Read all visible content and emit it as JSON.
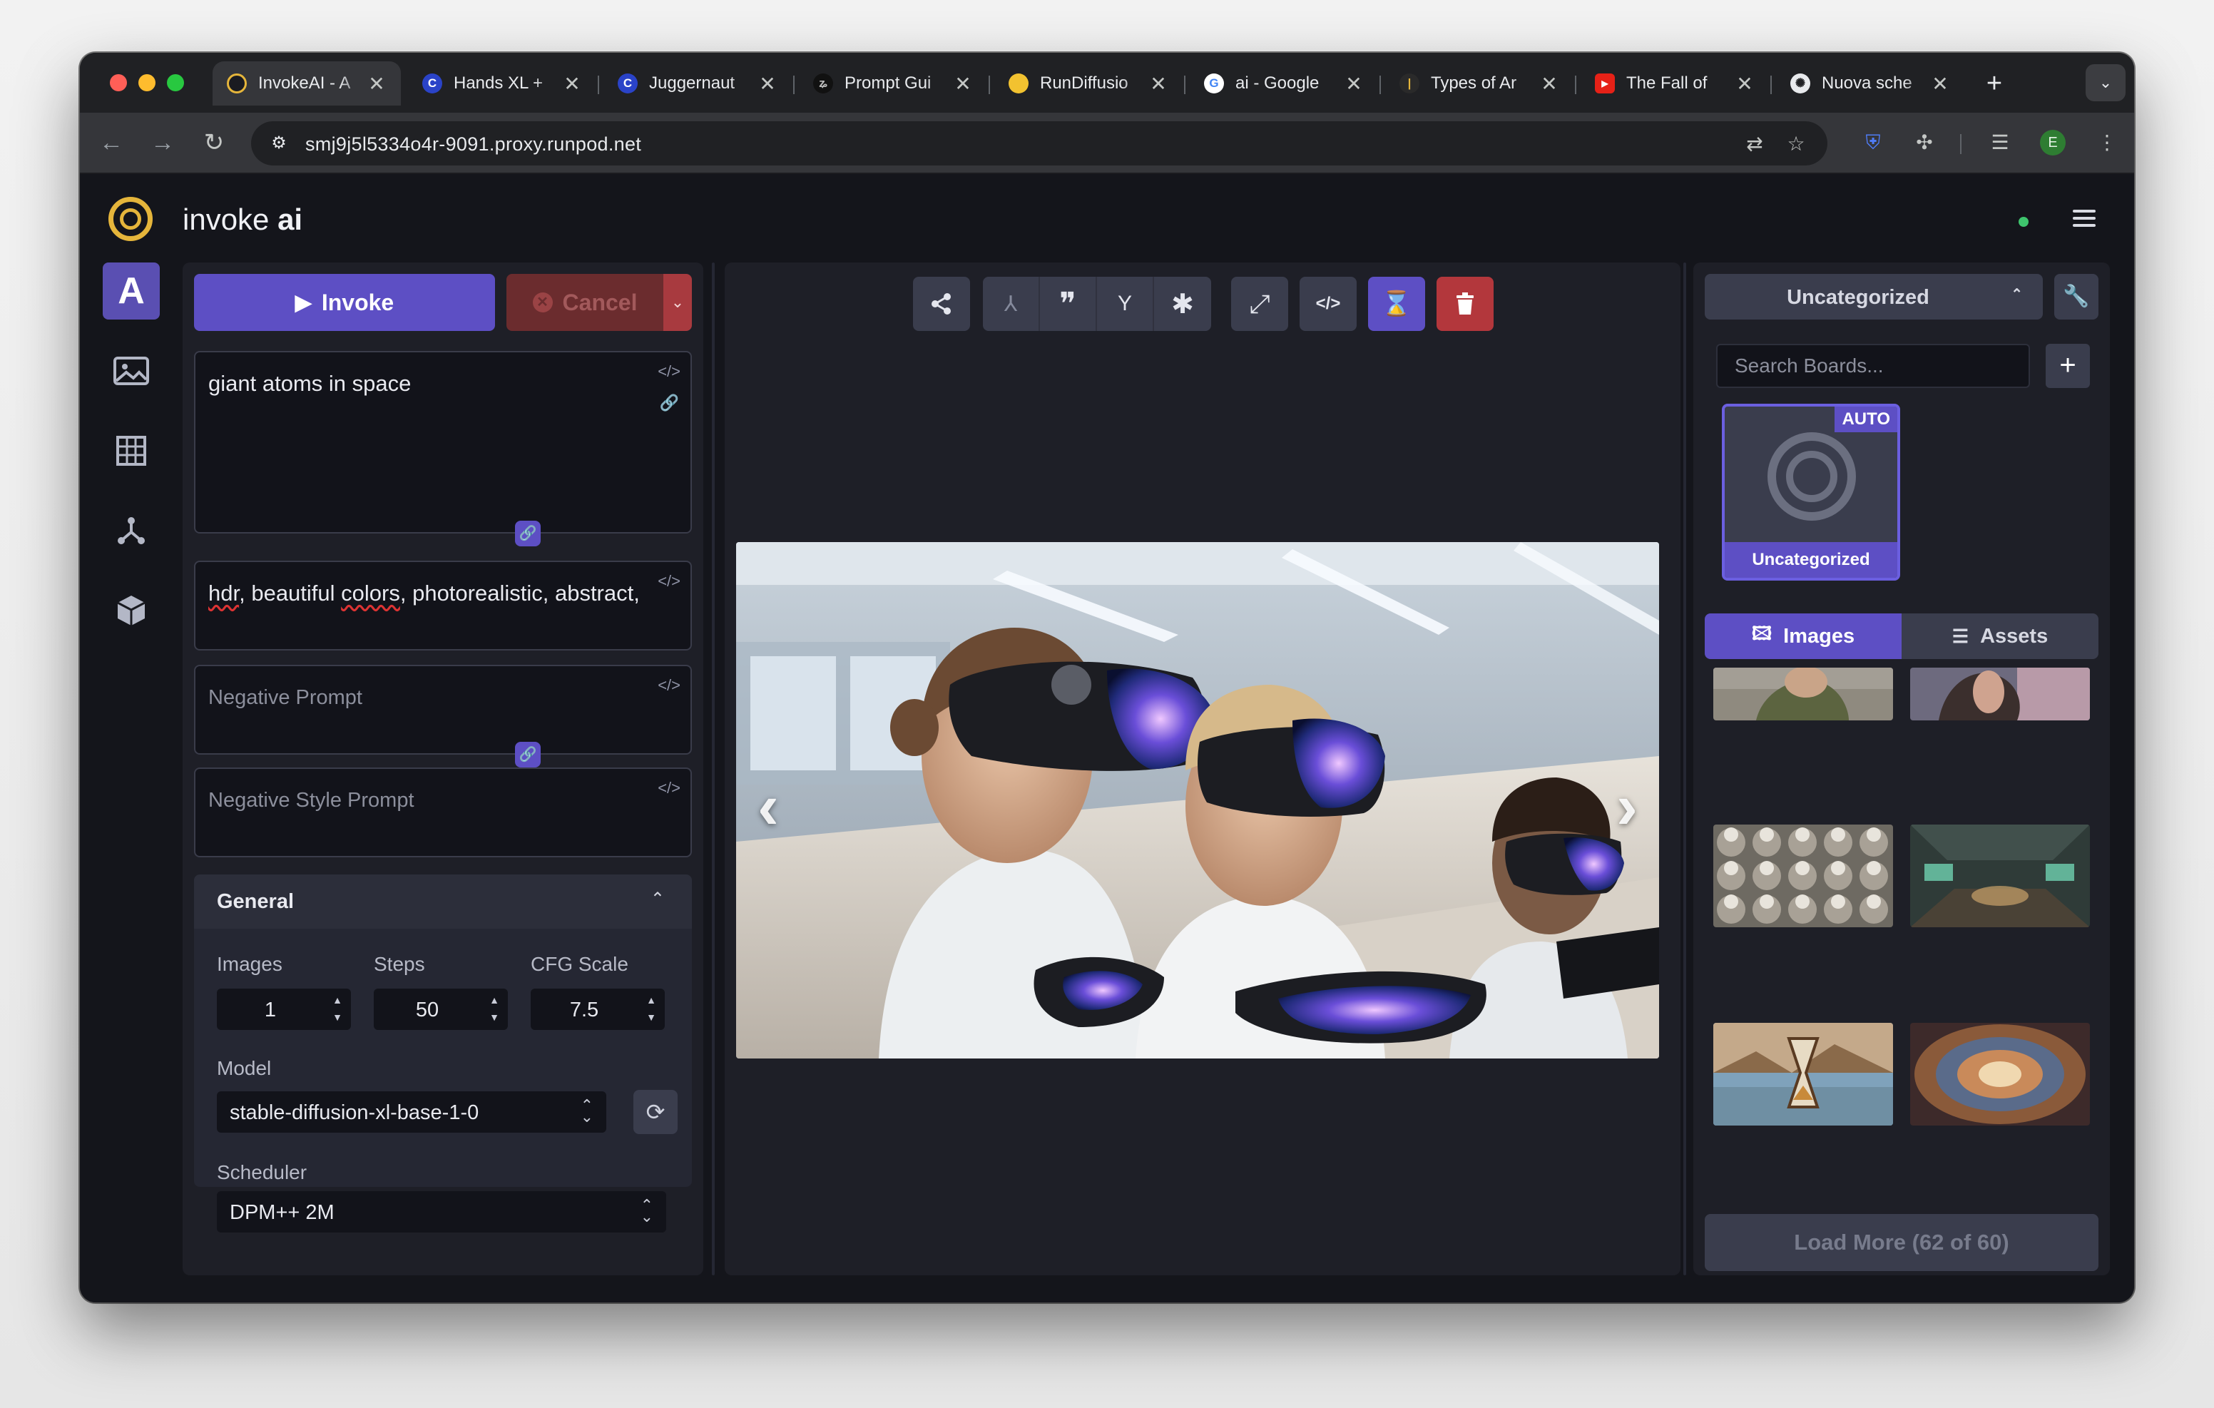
{
  "browser": {
    "tabs": [
      {
        "title": "InvokeAI - A",
        "icon": "invokeai-favicon",
        "active": true
      },
      {
        "title": "Hands XL +",
        "icon": "civitai-favicon"
      },
      {
        "title": "Juggernaut",
        "icon": "civitai-favicon"
      },
      {
        "title": "Prompt Gui",
        "icon": "prompt-guide-favicon"
      },
      {
        "title": "RunDiffusio",
        "icon": "rundiffusion-favicon"
      },
      {
        "title": "ai - Google",
        "icon": "google-favicon"
      },
      {
        "title": "Types of Ar",
        "icon": "types-favicon"
      },
      {
        "title": "The Fall of",
        "icon": "youtube-favicon"
      },
      {
        "title": "Nuova sche",
        "icon": "chatgpt-favicon"
      }
    ],
    "close_glyph": "✕",
    "new_tab_glyph": "+",
    "url": "smj9j5l5334o4r-9091.proxy.runpod.net",
    "profile_initial": "E"
  },
  "app": {
    "brand": {
      "prefix": "invoke",
      "suffix": "ai"
    },
    "rail": [
      {
        "name": "text-to-image-tab",
        "glyph": "A",
        "active": true
      },
      {
        "name": "image-to-image-tab",
        "glyph": "🖼"
      },
      {
        "name": "unified-canvas-tab",
        "glyph": "▦"
      },
      {
        "name": "workflow-editor-tab",
        "glyph": "⅄"
      },
      {
        "name": "model-manager-tab",
        "glyph": "⬢"
      }
    ],
    "invoke_label": "Invoke",
    "cancel_label": "Cancel",
    "prompt": "giant atoms in space",
    "style_prompt": "hdr, beautiful colors, photorealistic, abstract,",
    "style_prompt_parts": {
      "a": "hdr",
      "b": ", beautiful ",
      "c": "colors",
      "d": ", photorealistic, abstract,"
    },
    "negative_prompt_placeholder": "Negative Prompt",
    "negative_style_prompt_placeholder": "Negative Style Prompt",
    "general": {
      "title": "General",
      "images_label": "Images",
      "images_value": "1",
      "steps_label": "Steps",
      "steps_value": "50",
      "cfg_label": "CFG Scale",
      "cfg_value": "7.5",
      "model_label": "Model",
      "model_value": "stable-diffusion-xl-base-1-0",
      "scheduler_label": "Scheduler",
      "scheduler_value": "DPM++ 2M"
    },
    "viewer_tools": [
      {
        "name": "share-icon",
        "glyph": "⤴"
      },
      {
        "name": "use-all-icon",
        "glyph": "⅄",
        "dim": true
      },
      {
        "name": "quote-icon",
        "glyph": "❞"
      },
      {
        "name": "seed-icon",
        "glyph": "⚘"
      },
      {
        "name": "asterisk-icon",
        "glyph": "✱"
      },
      {
        "name": "expand-icon",
        "glyph": "⤢"
      },
      {
        "name": "code-icon",
        "glyph": "</>"
      },
      {
        "name": "hourglass-icon",
        "glyph": "⌛"
      },
      {
        "name": "trash-icon",
        "glyph": "🗑"
      }
    ],
    "main_image_alt": "Children wearing VR headsets in a classroom",
    "gallery": {
      "board_select": "Uncategorized",
      "search_placeholder": "Search Boards...",
      "board_name": "Uncategorized",
      "board_badge": "AUTO",
      "tab_images": "Images",
      "tab_assets": "Assets",
      "load_more": "Load More (62 of 60)"
    }
  },
  "colors": {
    "accent": "#5d4fc4",
    "danger": "#b3373c",
    "panel": "#1e1f27",
    "logo": "#e5b53b"
  }
}
